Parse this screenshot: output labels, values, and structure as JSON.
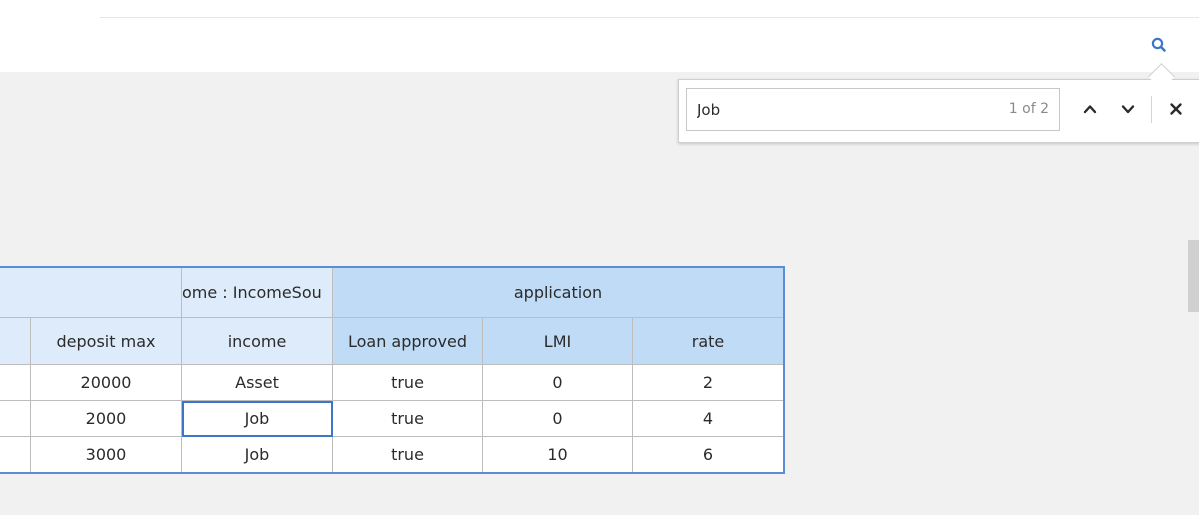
{
  "toolbar": {
    "search_icon": "search-icon"
  },
  "find": {
    "query": "Job",
    "count": "1 of 2",
    "icons": {
      "prev": "chevron-up-icon",
      "next": "chevron-down-icon",
      "close": "close-icon"
    }
  },
  "table": {
    "group_headers": {
      "left": "",
      "income_group": "ome : IncomeSou",
      "application": "application"
    },
    "columns": {
      "first": "",
      "deposit_max": "deposit max",
      "income": "income",
      "loan_approved": "Loan approved",
      "lmi": "LMI",
      "rate": "rate"
    },
    "rows": [
      {
        "first": "",
        "deposit_max": "20000",
        "income": "Asset",
        "loan_approved": "true",
        "lmi": "0",
        "rate": "2"
      },
      {
        "first": "",
        "deposit_max": "2000",
        "income": "Job",
        "loan_approved": "true",
        "lmi": "0",
        "rate": "4"
      },
      {
        "first": "",
        "deposit_max": "3000",
        "income": "Job",
        "loan_approved": "true",
        "lmi": "10",
        "rate": "6"
      }
    ]
  },
  "colors": {
    "accent": "#3b76c9",
    "header_light": "#ddebfa",
    "header_dark": "#bfdbf5",
    "canvas": "#f1f1f1"
  }
}
